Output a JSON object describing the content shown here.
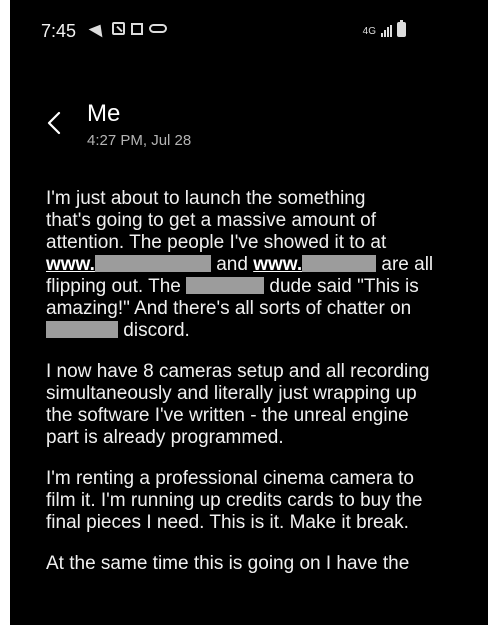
{
  "status_bar": {
    "time": "7:45",
    "network_label": "4G",
    "icons_left": [
      "send-icon",
      "missed-call-icon",
      "screenshot-icon",
      "voicemail-icon"
    ],
    "icons_right": [
      "data-4g-icon",
      "signal-icon",
      "battery-icon"
    ]
  },
  "header": {
    "title": "Me",
    "timestamp": "4:27 PM, Jul 28"
  },
  "body": {
    "p1": {
      "l1": "I'm just about to launch the something",
      "l2": "that's going to get a massive amount of",
      "l3": "attention.  The people I've showed it to at",
      "l4_link1": "www.",
      "l4_and": " and ",
      "l4_link2": "www.",
      "l4_tail": " are all",
      "l5_head": "flipping out.  The ",
      "l5_tail": " dude said \"This is",
      "l6": "amazing!\" And there's all sorts of chatter on",
      "l7_tail": " discord."
    },
    "p2": {
      "l1": "I now have 8 cameras setup and all recording",
      "l2": "simultaneously and literally just wrapping up",
      "l3": "the software I've written - the unreal engine",
      "l4": "part is already programmed."
    },
    "p3": {
      "l1": "I'm renting a professional cinema camera to",
      "l2": "film it.  I'm running up credits cards to buy the",
      "l3": "final pieces I need.  This is it.  Make it break."
    },
    "p4": {
      "l1": "At the same time this is going on I have the"
    }
  },
  "colors": {
    "background": "#000000",
    "text": "#f0f0f0",
    "subtext": "#b4b4b4",
    "redaction": "#9c9c9c"
  }
}
